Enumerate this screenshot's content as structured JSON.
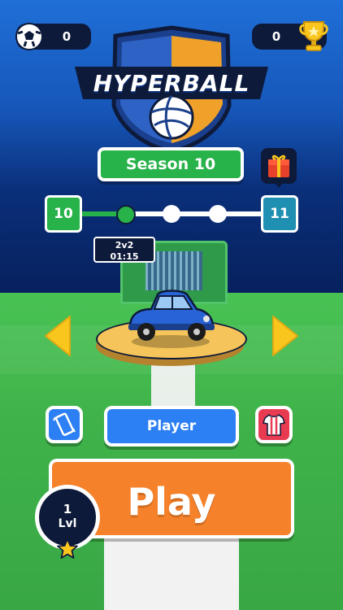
{
  "app": {
    "title": "HYPERBALL"
  },
  "top_bar": {
    "ball_count": "0",
    "trophy_count": "0"
  },
  "season": {
    "label": "Season 10"
  },
  "progress": {
    "current_level": "10",
    "next_level": "11",
    "nodes_filled": 1,
    "nodes_total": 3,
    "tooltip_mode": "2v2",
    "tooltip_time": "01:15"
  },
  "player_bar": {
    "label": "Player"
  },
  "play_button": {
    "label": "Play"
  },
  "level_badge": {
    "number": "1",
    "unit": "Lvl"
  },
  "colors": {
    "accent_green": "#27b24a",
    "accent_blue": "#2d7ff4",
    "accent_orange": "#f5812a",
    "accent_teal": "#1f8fb2",
    "arrow_yellow": "#f9c61e"
  },
  "icons": {
    "ball": "soccer-ball-icon",
    "trophy": "trophy-icon",
    "gift": "gift-icon",
    "phone": "phone-vibrate-icon",
    "jersey": "jersey-icon",
    "star": "star-icon",
    "left_arrow": "arrow-left-icon",
    "right_arrow": "arrow-right-icon"
  }
}
